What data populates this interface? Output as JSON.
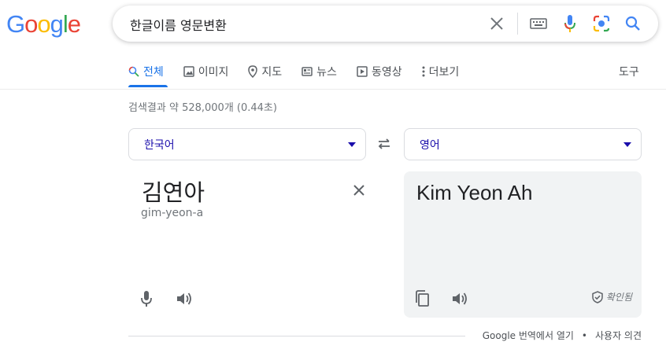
{
  "logo": {
    "letters": [
      "G",
      "o",
      "o",
      "g",
      "l",
      "e"
    ],
    "colors": [
      "#4285f4",
      "#ea4335",
      "#fbbc05",
      "#4285f4",
      "#34a853",
      "#ea4335"
    ]
  },
  "search": {
    "query": "한글이름 영문변환",
    "icons": [
      "clear-icon",
      "keyboard-icon",
      "mic-icon",
      "lens-icon",
      "search-icon"
    ]
  },
  "tabs": [
    {
      "label": "전체",
      "icon": "search-icon",
      "active": true
    },
    {
      "label": "이미지",
      "icon": "image-icon"
    },
    {
      "label": "지도",
      "icon": "map-pin-icon"
    },
    {
      "label": "뉴스",
      "icon": "news-icon"
    },
    {
      "label": "동영상",
      "icon": "video-icon"
    },
    {
      "label": "더보기",
      "icon": "more-icon"
    }
  ],
  "tools_label": "도구",
  "result_stats": "검색결과 약 528,000개 (0.44초)",
  "translator": {
    "source_lang": "한국어",
    "target_lang": "영어",
    "source_text": "김연아",
    "source_translit": "gim-yeon-a",
    "target_text": "Kim Yeon Ah",
    "verified_label": "확인됨"
  },
  "footer": {
    "open_in_translate": "Google 번역에서 열기",
    "separator": "•",
    "feedback": "사용자 의견"
  },
  "colors": {
    "accent": "#1a73e8",
    "link": "#1a0dab",
    "muted": "#70757a"
  }
}
